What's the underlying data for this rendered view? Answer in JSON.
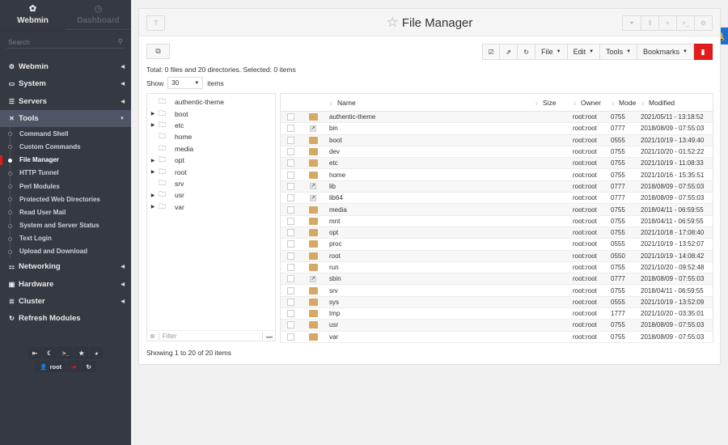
{
  "sidebar": {
    "tabs": [
      {
        "label": "Webmin",
        "icon": "webmin-logo-icon",
        "active": true
      },
      {
        "label": "Dashboard",
        "icon": "dashboard-gauge-icon",
        "active": false
      }
    ],
    "search_placeholder": "Search",
    "categories": [
      {
        "label": "Webmin",
        "icon": "gear-icon",
        "glyph": "⚙"
      },
      {
        "label": "System",
        "icon": "laptop-icon",
        "glyph": "▭"
      },
      {
        "label": "Servers",
        "icon": "server-icon",
        "glyph": "☰"
      },
      {
        "label": "Tools",
        "icon": "tools-icon",
        "glyph": "✕",
        "open": true
      },
      {
        "label": "Networking",
        "icon": "network-icon",
        "glyph": "⚏"
      },
      {
        "label": "Hardware",
        "icon": "hardware-icon",
        "glyph": "▣"
      },
      {
        "label": "Cluster",
        "icon": "cluster-icon",
        "glyph": "≣"
      },
      {
        "label": "Refresh Modules",
        "icon": "refresh-icon",
        "glyph": "↻"
      }
    ],
    "tools_items": [
      "Command Shell",
      "Custom Commands",
      "File Manager",
      "HTTP Tunnel",
      "Perl Modules",
      "Protected Web Directories",
      "Read User Mail",
      "System and Server Status",
      "Text Login",
      "Upload and Download"
    ],
    "active_item": "File Manager",
    "bottom_buttons": {
      "collapse": "⇤",
      "night_mode": "☾",
      "terminal": ">_",
      "favorites": "★",
      "theme": "◕",
      "user": "root",
      "logout": "➜",
      "reload": "↻"
    }
  },
  "header": {
    "title": "File Manager",
    "help": "?",
    "star": "☆",
    "right_icons": [
      "⏷",
      "⦀",
      "+",
      ">_",
      "⚙"
    ]
  },
  "notification_icon": "🔔",
  "toolbar": {
    "copy_icon": "⧉",
    "select_all_icon": "☑",
    "open_icon": "⇗",
    "refresh_icon": "↻",
    "menus": [
      "File",
      "Edit",
      "Tools",
      "Bookmarks"
    ],
    "delete_icon": "🗑"
  },
  "summary": "Total: 0 files and 20 directories. Selected: 0 items",
  "show": {
    "prefix": "Show",
    "value": "30",
    "suffix": "items"
  },
  "tree": {
    "items": [
      {
        "name": "authentic-theme",
        "expandable": false
      },
      {
        "name": "boot",
        "expandable": true
      },
      {
        "name": "etc",
        "expandable": true
      },
      {
        "name": "home",
        "expandable": false
      },
      {
        "name": "media",
        "expandable": false
      },
      {
        "name": "opt",
        "expandable": true
      },
      {
        "name": "root",
        "expandable": true
      },
      {
        "name": "srv",
        "expandable": false
      },
      {
        "name": "usr",
        "expandable": true
      },
      {
        "name": "var",
        "expandable": true
      }
    ],
    "filter_placeholder": "Filter"
  },
  "table": {
    "columns": [
      "Name",
      "Size",
      "Owner",
      "Mode",
      "Modified"
    ],
    "rows": [
      {
        "type": "folder",
        "name": "authentic-theme",
        "size": "",
        "owner": "root:root",
        "mode": "0755",
        "modified": "2021/05/11 - 13:18:52"
      },
      {
        "type": "link",
        "name": "bin",
        "size": "",
        "owner": "root:root",
        "mode": "0777",
        "modified": "2018/08/09 - 07:55:03"
      },
      {
        "type": "folder",
        "name": "boot",
        "size": "",
        "owner": "root:root",
        "mode": "0555",
        "modified": "2021/10/19 - 13:49:40"
      },
      {
        "type": "folder",
        "name": "dev",
        "size": "",
        "owner": "root:root",
        "mode": "0755",
        "modified": "2021/10/20 - 01:52:22"
      },
      {
        "type": "folder",
        "name": "etc",
        "size": "",
        "owner": "root:root",
        "mode": "0755",
        "modified": "2021/10/19 - 11:08:33"
      },
      {
        "type": "folder",
        "name": "home",
        "size": "",
        "owner": "root:root",
        "mode": "0755",
        "modified": "2021/10/16 - 15:35:51"
      },
      {
        "type": "link",
        "name": "lib",
        "size": "",
        "owner": "root:root",
        "mode": "0777",
        "modified": "2018/08/09 - 07:55:03"
      },
      {
        "type": "link",
        "name": "lib64",
        "size": "",
        "owner": "root:root",
        "mode": "0777",
        "modified": "2018/08/09 - 07:55:03"
      },
      {
        "type": "folder",
        "name": "media",
        "size": "",
        "owner": "root:root",
        "mode": "0755",
        "modified": "2018/04/11 - 06:59:55"
      },
      {
        "type": "folder",
        "name": "mnt",
        "size": "",
        "owner": "root:root",
        "mode": "0755",
        "modified": "2018/04/11 - 06:59:55"
      },
      {
        "type": "folder",
        "name": "opt",
        "size": "",
        "owner": "root:root",
        "mode": "0755",
        "modified": "2021/10/18 - 17:08:40"
      },
      {
        "type": "folder",
        "name": "proc",
        "size": "",
        "owner": "root:root",
        "mode": "0555",
        "modified": "2021/10/19 - 13:52:07"
      },
      {
        "type": "folder",
        "name": "root",
        "size": "",
        "owner": "root:root",
        "mode": "0550",
        "modified": "2021/10/19 - 14:08:42"
      },
      {
        "type": "folder",
        "name": "run",
        "size": "",
        "owner": "root:root",
        "mode": "0755",
        "modified": "2021/10/20 - 09:52:48"
      },
      {
        "type": "link",
        "name": "sbin",
        "size": "",
        "owner": "root:root",
        "mode": "0777",
        "modified": "2018/08/09 - 07:55:03"
      },
      {
        "type": "folder",
        "name": "srv",
        "size": "",
        "owner": "root:root",
        "mode": "0755",
        "modified": "2018/04/11 - 06:59:55"
      },
      {
        "type": "folder",
        "name": "sys",
        "size": "",
        "owner": "root:root",
        "mode": "0555",
        "modified": "2021/10/19 - 13:52:09"
      },
      {
        "type": "folder",
        "name": "tmp",
        "size": "",
        "owner": "root:root",
        "mode": "1777",
        "modified": "2021/10/20 - 03:35:01"
      },
      {
        "type": "folder",
        "name": "usr",
        "size": "",
        "owner": "root:root",
        "mode": "0755",
        "modified": "2018/08/09 - 07:55:03"
      },
      {
        "type": "folder",
        "name": "var",
        "size": "",
        "owner": "root:root",
        "mode": "0755",
        "modified": "2018/08/09 - 07:55:03"
      }
    ]
  },
  "footer": "Showing 1 to 20 of 20 items",
  "colors": {
    "accent_red": "#e21c1c",
    "notify_blue": "#1f6fd1",
    "folder": "#d6a866",
    "sidebar_bg": "#353942"
  }
}
